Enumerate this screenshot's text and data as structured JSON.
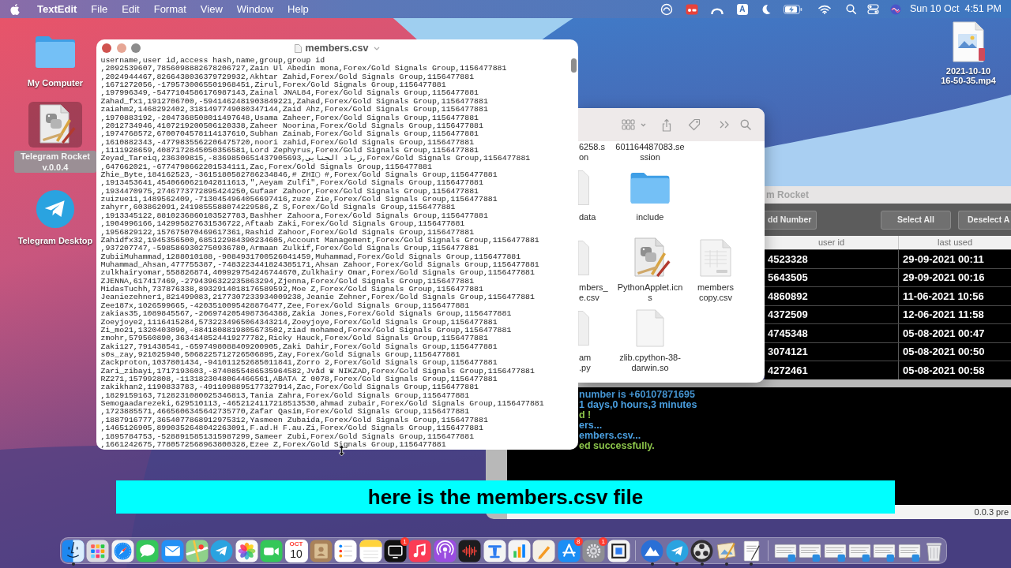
{
  "menu_bar": {
    "app_name": "TextEdit",
    "menus": [
      "File",
      "Edit",
      "Format",
      "View",
      "Window",
      "Help"
    ],
    "input_source": "A",
    "date": "Sun 10 Oct",
    "time": "4:51 PM"
  },
  "desktop": {
    "left_icons": [
      {
        "label": "My Computer",
        "selected": false
      },
      {
        "label": "Telegram Rocket v.0.0.4",
        "selected": true
      },
      {
        "label": "Telegram Desktop",
        "selected": false
      }
    ],
    "right_icons": [
      {
        "label": "2021-10-10 16-50-35.mp4",
        "selected": false
      }
    ]
  },
  "textedit_window": {
    "title": "members.csv",
    "lines": [
      "username,user id,access hash,name,group,group id",
      ",2092539607,7856098882678206727,Zain Ul Abedin mona,Forex/Gold Signals Group,1156477881",
      ",2024944467,8266438036379729932,Akhtar Zahid,Forex/Gold Signals Group,1156477881",
      ",1671272056,-1795730065501968451,Zirul,Forex/Gold Signals Group,1156477881",
      ",197996349,-5477104586176987143,Zainal JNAL84,Forex/Gold Signals Group,1156477881",
      "Zahad_fx1,1912706700,-5941462481903849221,Zahad,Forex/Gold Signals Group,1156477881",
      "zaiahm2,1468292402,3181497749080347144,Zaid Ahz,Forex/Gold Signals Group,1156477881",
      ",1970883192,-2047368508011497648,Usama Zaheer,Forex/Gold Signals Group,1156477881",
      ",2012734946,4107219200506120338,Zaheer Noorina,Forex/Gold Signals Group,1156477881",
      ",1974768572,6700704578114137610,Subhan Zainab,Forex/Gold Signals Group,1156477881",
      ",1610882343,-4779835562206475720,noori zahid,Forex/Gold Signals Group,1156477881",
      ",1111928659,4087172845050356581,Lord Zephyrus,Forex/Gold Signals Group,1156477881",
      "Zeyad_Tareiq,236309815,-8369850651437905693,زياد الجنابي,Forex/Gold Signals Group,1156477881",
      ",647662021,-6774798662201534111,Zac,Forex/Gold Signals Group,1156477881",
      "Zhie_Byte,184162523,-3615180582786234846,# ZHI▢ #,Forex/Gold Signals Group,1156477881",
      ",1913453641,4540660621042811613,\",Aeyam Zulfi\",Forex/Gold Signals Group,1156477881",
      ",1934470975,2746773772895424250,Gufaar Zahoor,Forex/Gold Signals Group,1156477881",
      "zuizue11,1489562409,-7130454964056697416,zuze Zie,Forex/Gold Signals Group,1156477881",
      "zahyrr,603862091,2419855588074229586,Z S,Forex/Gold Signals Group,1156477881",
      ",1913345122,8810236860103527783,Bashher Zahoora,Forex/Gold Signals Group,1156477881",
      ",1904996166,142995827631536722,Aftaab Zaki,Forex/Gold Signals Group,1156477881",
      ",1956829122,157675070469617361,Rashid Zahoor,Forex/Gold Signals Group,1156477881",
      "Zahidfx32,1945356500,685122984390234605,Account Management,Forex/Gold Signals Group,1156477881",
      ",937207747,-5985869302750936780,Armaan Zulkif,Forex/Gold Signals Group,1156477881",
      "ZubiiMuhammad,1288010188,-9084931700526041459,Muhammad,Forex/Gold Signals Group,1156477881",
      "Muhammad_Ahsan,477755387,-7483223441824385171,Ahsan Zahoor,Forex/Gold Signals Group,1156477881",
      "zulkhairyomar,558826874,409929754246744670,Zulkhairy Omar,Forex/Gold Signals Group,1156477881",
      "ZJENNA,617417469,-2794396322235863294,Zjenna,Forex/Gold Signals Group,1156477881",
      "MidasTuchh,737876338,8932914018176589592,Moe Z,Forex/Gold Signals Group,1156477881",
      "Jeaniezehner1,821499083,2177307233934009238,Jeanie Zehner,Forex/Gold Signals Group,1156477881",
      "Zee187x,1026599665,-4203510095428876477,Zee,Forex/Gold Signals Group,1156477881",
      "zakias35,1089845567,-2069742054987364388,Zakia Jones,Forex/Gold Signals Group,1156477881",
      "Zoeyjoye2,1116415284,5732234965064343214,Zoeyjoye,Forex/Gold Signals Group,1156477881",
      "Zi_mo21,1320403090,-8841808819805673502,ziad mohamed,Forex/Gold Signals Group,1156477881",
      "zmohr,579560890,3634148524419277782,Ricky Hauck,Forex/Gold Signals Group,1156477881",
      "Zaki127,791438541,-6597498088409200905,Zaki Dahir,Forex/Gold Signals Group,1156477881",
      "s0s_zay,921025940,5068225712726506895,Zay,Forex/Gold Signals Group,1156477881",
      "Zackproton,1037801434,-941011252685011841,Zorro 2,Forex/Gold Signals Group,1156477881",
      "Zari_zibayi,1717193603,-8740855486535964582,Jvåd ♛ NIKZAD,Forex/Gold Signals Group,1156477881",
      "RZ271,157992808,-1131823048064466561,ABATA Z 0078,Forex/Gold Signals Group,1156477881",
      "zakikhan2,1190833783,-4911098895177327914,Zac,Forex/Gold Signals Group,1156477881",
      ",1829159163,7128231080025346813,Tania Zahra,Forex/Gold Signals Group,1156477881",
      "Semogaadarezeki,629510113,-4652124117218513530,ahmad zubair,Forex/Gold Signals Group,1156477881",
      ",1723885571,4665606345642735770,Zafar Qasim,Forex/Gold Signals Group,1156477881",
      ",1887916777,3654077868912975312,Yasmeen Zubaida,Forex/Gold Signals Group,1156477881",
      ",1465126905,8990352648042263091,F.ad.H F.au.Zi,Forex/Gold Signals Group,1156477881",
      ",1895784753,-5288915851315987299,Sameer Zubi,Forex/Gold Signals Group,1156477881",
      ",1661242675,7780572568963800328,Ezee Z,Forex/Gold Signals Group,1156477881"
    ]
  },
  "finder_window": {
    "rows": [
      [
        {
          "lines": [
            "6258.s",
            "on"
          ]
        },
        {
          "lines": [
            "601164487083.se",
            "ssion"
          ]
        }
      ],
      [
        {
          "lines": [
            "data"
          ]
        },
        {
          "lines": [
            "include"
          ]
        }
      ],
      [
        {
          "lines": [
            "mbers_",
            "e.csv"
          ]
        },
        {
          "lines": [
            "PythonApplet.icn",
            "s"
          ]
        },
        {
          "lines": [
            "members",
            "copy.csv"
          ]
        }
      ],
      [
        {
          "lines": [
            "am",
            ".py"
          ]
        },
        {
          "lines": [
            "zlib.cpython-38-",
            "darwin.so"
          ]
        }
      ]
    ]
  },
  "rocket_window": {
    "title": "m Rocket",
    "buttons": [
      "dd Number",
      "Select All",
      "Deselect A"
    ],
    "table": {
      "columns": [
        "user id",
        "last used"
      ],
      "rows": [
        [
          "4523328",
          "29-09-2021 00:11"
        ],
        [
          "5643505",
          "29-09-2021 00:16"
        ],
        [
          "4860892",
          "11-06-2021 10:56"
        ],
        [
          "4372509",
          "12-06-2021 11:58"
        ],
        [
          "4745348",
          "05-08-2021 00:47"
        ],
        [
          "3074121",
          "05-08-2021 00:50"
        ],
        [
          "4272461",
          "05-08-2021 00:58"
        ]
      ]
    },
    "log": [
      {
        "text": "number is +60107871695",
        "color": "#4a9fe0"
      },
      {
        "text": "1 days,0 hours,3 minutes",
        "color": "#4a9fe0"
      },
      {
        "text": "d !",
        "color": "#8bc34a"
      },
      {
        "text": "ers...",
        "color": "#4a9fe0"
      },
      {
        "text": "embers.csv...",
        "color": "#4a9fe0"
      },
      {
        "text": "ed successfully.",
        "color": "#8bc34a"
      }
    ],
    "status": "0.0.3 pre"
  },
  "caption": "here is the members.csv file",
  "dock": {
    "items": [
      {
        "running": true
      },
      {
        "running": false
      },
      {
        "running": false
      },
      {
        "running": false
      },
      {
        "running": false
      },
      {
        "running": false
      },
      {
        "running": false
      },
      {
        "running": false
      },
      {
        "running": false
      },
      {
        "running": false,
        "month": "OCT",
        "day": "10"
      },
      {
        "running": false
      },
      {
        "running": false
      },
      {
        "running": false
      },
      {
        "running": false,
        "badge": "1"
      },
      {
        "running": false
      },
      {
        "running": false
      },
      {
        "running": false
      },
      {
        "running": false
      },
      {
        "running": false
      },
      {
        "running": false
      },
      {
        "running": false,
        "badge": "8"
      },
      {
        "running": false,
        "badge": "1"
      },
      {
        "running": false
      },
      {
        "running": true
      },
      {
        "running": true
      },
      {
        "running": true
      },
      {
        "running": true
      },
      {
        "running": true
      },
      {
        "running": false
      },
      {
        "running": false
      },
      {
        "running": false
      },
      {
        "running": false
      },
      {
        "running": false
      },
      {
        "running": false
      },
      {
        "running": false
      }
    ]
  }
}
